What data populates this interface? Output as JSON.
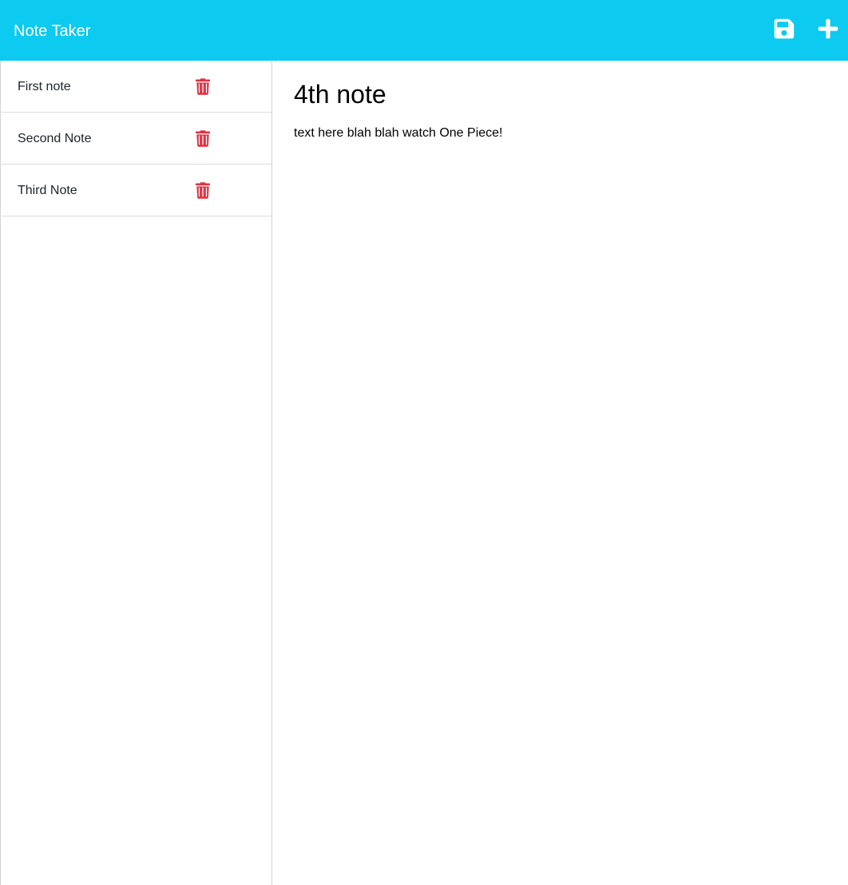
{
  "navbar": {
    "brand": "Note Taker",
    "bg_color": "#0dcaf0",
    "save_icon": "floppy-disk-icon",
    "new_icon": "plus-icon"
  },
  "sidebar": {
    "notes": [
      {
        "title": "First note",
        "delete_icon": "trash-icon"
      },
      {
        "title": "Second Note",
        "delete_icon": "trash-icon"
      },
      {
        "title": "Third Note",
        "delete_icon": "trash-icon"
      }
    ],
    "delete_color": "#dc3545"
  },
  "editor": {
    "title_value": "4th note",
    "text_value": "text here blah blah watch One Piece!"
  }
}
